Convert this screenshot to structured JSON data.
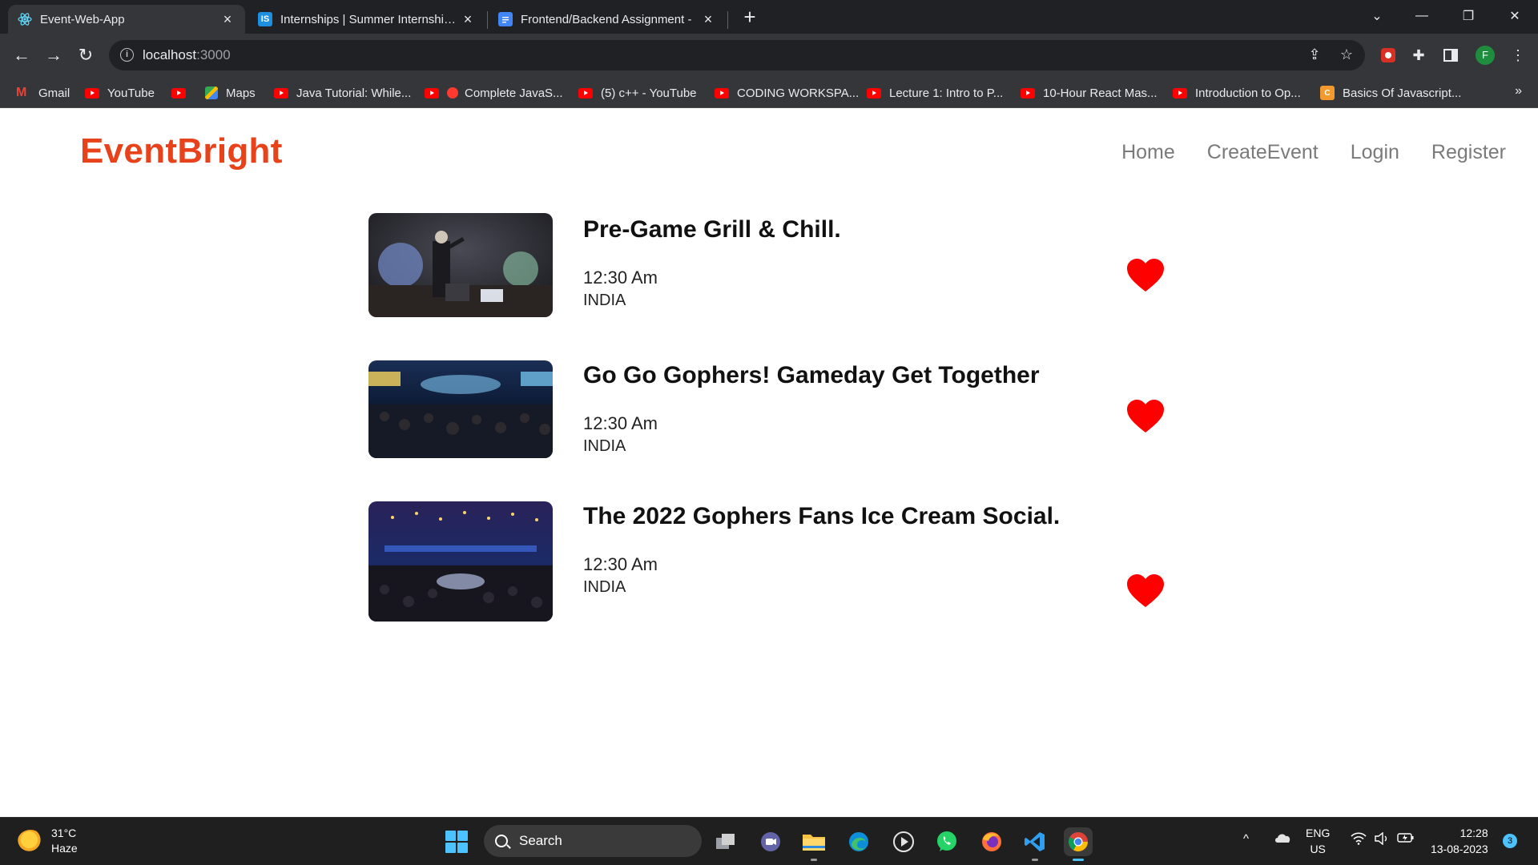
{
  "browser": {
    "tabs": [
      {
        "title": "Event-Web-App",
        "active": true
      },
      {
        "title": "Internships | Summer Internship 2",
        "active": false
      },
      {
        "title": "Frontend/Backend Assignment - ",
        "active": false
      }
    ],
    "url_host": "localhost",
    "url_port": ":3000",
    "profile_initial": "F",
    "bookmarks": [
      "Gmail",
      "YouTube",
      "Maps",
      "Java Tutorial: While...",
      "Complete JavaS...",
      "(5) c++ - YouTube",
      "CODING WORKSPA...",
      "Lecture 1: Intro to P...",
      "10-Hour React Mas...",
      "Introduction to Op...",
      "Basics Of Javascript..."
    ],
    "bookmarks_more": "»"
  },
  "site": {
    "brand": "EventBright",
    "nav": [
      "Home",
      "CreateEvent",
      "Login",
      "Register"
    ]
  },
  "events": [
    {
      "title": "Pre-Game Grill & Chill.",
      "time": "12:30 Am",
      "country": "INDIA"
    },
    {
      "title": "Go Go Gophers! Gameday Get Together",
      "time": "12:30 Am",
      "country": "INDIA"
    },
    {
      "title": "The 2022 Gophers Fans Ice Cream Social.",
      "time": "12:30 Am",
      "country": "INDIA"
    }
  ],
  "taskbar": {
    "temperature": "31°C",
    "condition": "Haze",
    "search_label": "Search",
    "lang_line1": "ENG",
    "lang_line2": "US",
    "time": "12:28",
    "date": "13-08-2023",
    "notifications": "3"
  },
  "colors": {
    "brand": "#e8421b",
    "heart": "#ff0000",
    "nav_text": "#7a7a7a"
  }
}
